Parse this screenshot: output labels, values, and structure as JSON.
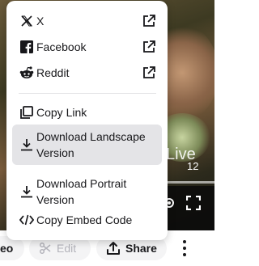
{
  "video": {
    "overlay_text": "Live",
    "overlay_number": "12"
  },
  "menu": {
    "items": [
      {
        "label": "X",
        "icon": "x-logo-icon",
        "external": true
      },
      {
        "label": "Facebook",
        "icon": "facebook-icon",
        "external": true
      },
      {
        "label": "Reddit",
        "icon": "reddit-icon",
        "external": true
      },
      {
        "label": "Copy Link",
        "icon": "copy-icon",
        "external": false
      },
      {
        "label": "Download Landscape Version",
        "icon": "download-icon",
        "external": false,
        "highlighted": true
      },
      {
        "label": "Download Portrait Version",
        "icon": "download-icon",
        "external": false
      },
      {
        "label": "Copy Embed Code",
        "icon": "code-icon",
        "external": false
      }
    ]
  },
  "actionbar": {
    "video_label": "eo",
    "edit_label": "Edit",
    "share_label": "Share"
  },
  "colors": {
    "menu_bg": "#ffffff",
    "highlight_bg": "#e4e4e7",
    "pill_bg": "#f4f4f5",
    "text": "#18181b",
    "disabled_text": "#b4b4bb"
  }
}
